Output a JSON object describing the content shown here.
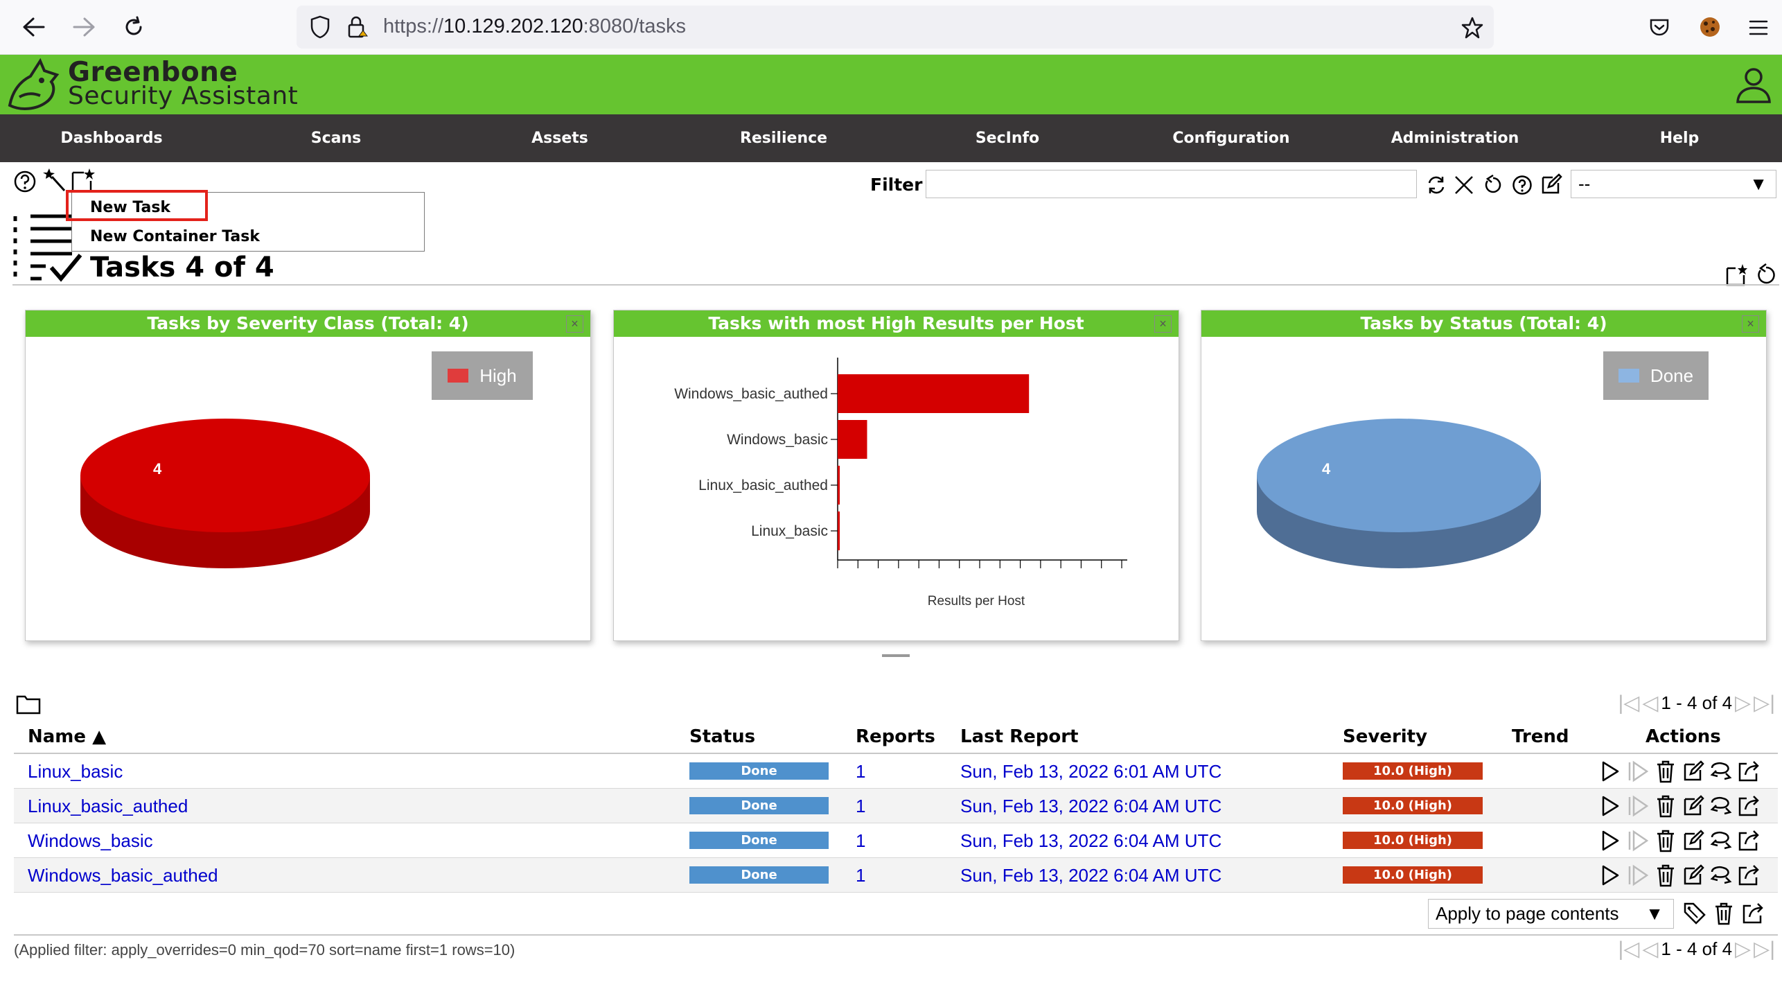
{
  "browser": {
    "url_scheme": "https://",
    "url_host": "10.129.202.120",
    "url_rest": ":8080/tasks"
  },
  "app": {
    "title_line1": "Greenbone",
    "title_line2": "Security Assistant"
  },
  "menu": [
    "Dashboards",
    "Scans",
    "Assets",
    "Resilience",
    "SecInfo",
    "Configuration",
    "Administration",
    "Help"
  ],
  "toolbar": {
    "filter_label": "Filter",
    "filter_value": "",
    "filter_select_value": "--"
  },
  "new_menu": {
    "items": [
      "New Task",
      "New Container Task"
    ]
  },
  "page": {
    "title": "Tasks 4 of 4"
  },
  "panels": [
    {
      "title": "Tasks by Severity Class (Total: 4)",
      "legend": "High",
      "slice_label": "4",
      "color": "#d40000"
    },
    {
      "title": "Tasks with most High Results per Host",
      "xlabel": "Results per Host"
    },
    {
      "title": "Tasks by Status (Total: 4)",
      "legend": "Done",
      "slice_label": "4",
      "color": "#6f9ed2"
    }
  ],
  "chart_data": [
    {
      "type": "pie",
      "title": "Tasks by Severity Class (Total: 4)",
      "categories": [
        "High"
      ],
      "values": [
        4
      ],
      "legend": "top-right"
    },
    {
      "type": "bar",
      "orientation": "horizontal",
      "title": "Tasks with most High Results per Host",
      "categories": [
        "Windows_basic_authed",
        "Windows_basic",
        "Linux_basic_authed",
        "Linux_basic"
      ],
      "values": [
        13,
        2,
        0.1,
        0.1
      ],
      "xlabel": "Results per Host",
      "ylabel": ""
    },
    {
      "type": "pie",
      "title": "Tasks by Status (Total: 4)",
      "categories": [
        "Done"
      ],
      "values": [
        4
      ],
      "legend": "top-right"
    }
  ],
  "table": {
    "pager_text": "1 - 4 of 4",
    "headers": {
      "name": "Name ▲",
      "status": "Status",
      "reports": "Reports",
      "last_report": "Last Report",
      "severity": "Severity",
      "trend": "Trend",
      "actions": "Actions"
    },
    "rows": [
      {
        "name": "Linux_basic",
        "status": "Done",
        "reports": "1",
        "last_report": "Sun, Feb 13, 2022 6:01 AM UTC",
        "severity": "10.0 (High)",
        "trend": ""
      },
      {
        "name": "Linux_basic_authed",
        "status": "Done",
        "reports": "1",
        "last_report": "Sun, Feb 13, 2022 6:04 AM UTC",
        "severity": "10.0 (High)",
        "trend": ""
      },
      {
        "name": "Windows_basic",
        "status": "Done",
        "reports": "1",
        "last_report": "Sun, Feb 13, 2022 6:04 AM UTC",
        "severity": "10.0 (High)",
        "trend": ""
      },
      {
        "name": "Windows_basic_authed",
        "status": "Done",
        "reports": "1",
        "last_report": "Sun, Feb 13, 2022 6:04 AM UTC",
        "severity": "10.0 (High)",
        "trend": ""
      }
    ],
    "apply_select": "Apply to page contents",
    "applied_filter": "(Applied filter: apply_overrides=0 min_qod=70 sort=name first=1 rows=10)"
  }
}
